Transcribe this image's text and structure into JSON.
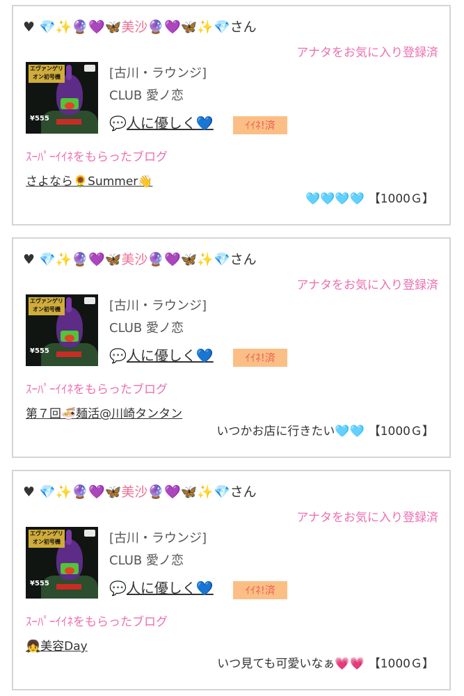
{
  "items": [
    {
      "user": {
        "prefix": "♥ 💎✨🔮💜🦋",
        "name": "美沙",
        "suffix": "🔮💜🦋✨💎",
        "honorific": "さん"
      },
      "fav_status": "アナタをお気に入り登録済",
      "shop": "[古川・ラウンジ]",
      "club": "CLUB 愛ノ恋",
      "kind_icon": "💬",
      "kind_text": "人に優しく💙",
      "iine_badge": "ｲｲﾈ!済",
      "super_label": "ｽｰﾊﾟｰｲｲﾈをもらったブログ",
      "blog_title": "さよなら🌻Summer👋",
      "reward_message": "🩵🩵🩵🩵",
      "reward_amount": "【1000Ｇ】"
    },
    {
      "user": {
        "prefix": "♥ 💎✨🔮💜🦋",
        "name": "美沙",
        "suffix": "🔮💜🦋✨💎",
        "honorific": "さん"
      },
      "fav_status": "アナタをお気に入り登録済",
      "shop": "[古川・ラウンジ]",
      "club": "CLUB 愛ノ恋",
      "kind_icon": "💬",
      "kind_text": "人に優しく💙",
      "iine_badge": "ｲｲﾈ!済",
      "super_label": "ｽｰﾊﾟｰｲｲﾈをもらったブログ",
      "blog_title": "第７回🍜麺活@川崎タンタン",
      "reward_message": "いつかお店に行きたい🩵🩵",
      "reward_amount": "【1000Ｇ】"
    },
    {
      "user": {
        "prefix": "♥ 💎✨🔮💜🦋",
        "name": "美沙",
        "suffix": "🔮💜🦋✨💎",
        "honorific": "さん"
      },
      "fav_status": "アナタをお気に入り登録済",
      "shop": "[古川・ラウンジ]",
      "club": "CLUB 愛ノ恋",
      "kind_icon": "💬",
      "kind_text": "人に優しく💙",
      "iine_badge": "ｲｲﾈ!済",
      "super_label": "ｽｰﾊﾟｰｲｲﾈをもらったブログ",
      "blog_title": "👧美容Day",
      "reward_message": "いつ見ても可愛いなぁ💗💗",
      "reward_amount": "【1000Ｇ】"
    }
  ],
  "thumbnail": {
    "banner_text": "エヴァンゲリオン初号機",
    "price_text": "¥555"
  },
  "colors": {
    "pink_text": "#ee6fb0",
    "badge_bg": "#fbbf86",
    "badge_text": "#ee5f54",
    "border": "#d4d4d4"
  }
}
